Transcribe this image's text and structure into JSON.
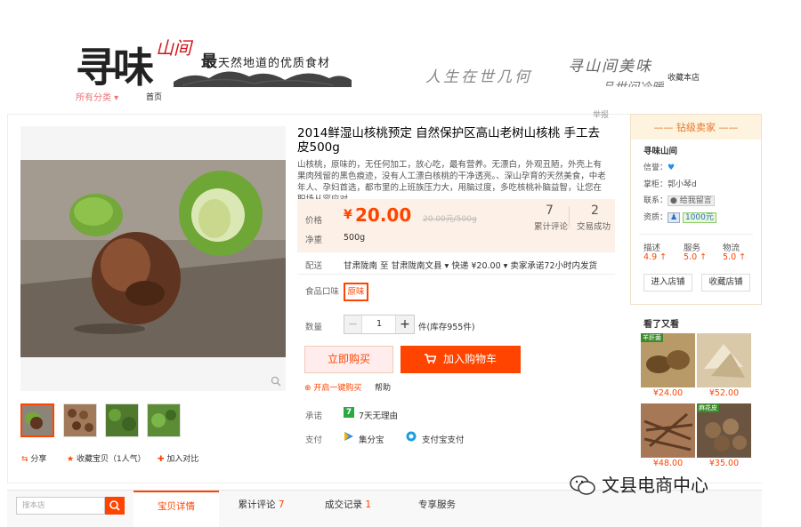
{
  "banner": {
    "logo_main": "寻味",
    "logo_red": "山间",
    "slogan_first": "最",
    "slogan_rest": "天然地道的优质食材",
    "text1": "人生在世几何",
    "text2": "寻山间美味",
    "text3": "品世间冷暖",
    "fav_shop": "收藏本店"
  },
  "nav": {
    "categories": "所有分类 ▾",
    "home": "首页"
  },
  "report": "举报",
  "product": {
    "title": "2014鲜湿山核桃预定 自然保护区高山老树山核桃 手工去皮500g",
    "description": "山核桃，原味的，无任何加工，放心吃，最有营养。无漂白，外观丑陋，外壳上有果肉残留的黑色痕迹，没有人工漂白核桃的干净透亮。、深山孕育的天然美食，中老年人、孕妇首选，都市里的上班族压力大，用脑过度，多吃核桃补脑益智，让您在职场从容应对",
    "price_label": "价格",
    "currency": "¥",
    "price": "20.00",
    "unit_price": "20.00元/500g",
    "reviews_count": "7",
    "reviews_label": "累计评论",
    "sales_count": "2",
    "sales_label": "交易成功",
    "weight_label": "净重",
    "weight": "500g",
    "shipping_label": "配送",
    "shipping": "甘肃陇南 至  甘肃陇南文县 ▾  快递 ¥20.00 ▾    卖家承诺72小时内发货",
    "flavor_label": "食品口味",
    "flavor_option": "原味",
    "qty_label": "数量",
    "qty_minus": "−",
    "qty": "1",
    "qty_plus": "+",
    "qty_unit": "件(库存955件)",
    "buy_now": "立即购买",
    "add_cart": "加入购物车",
    "onekey": "开启一键购买",
    "help": "帮助",
    "promise_label": "承诺",
    "promise_icon": "7",
    "promise": "7天无理由",
    "pay_label": "支付",
    "pay1": "集分宝",
    "pay2": "支付宝支付",
    "share": "分享",
    "collect": "收藏宝贝（1人气）",
    "compare": "加入对比"
  },
  "seller": {
    "title": "钻级卖家",
    "shop_name": "寻味山间",
    "credit_label": "信誉：",
    "keeper": "掌柜：郭小琴d",
    "contact_label": "联系：",
    "contact": "给我留言",
    "deposit_label": "资质：",
    "deposit": "1000元",
    "ratings": [
      {
        "label": "描述",
        "value": "4.9 ↑"
      },
      {
        "label": "服务",
        "value": "5.0 ↑"
      },
      {
        "label": "物流",
        "value": "5.0 ↑"
      }
    ],
    "enter_shop": "进入店铺",
    "fav_shop": "收藏店铺"
  },
  "also_viewed": {
    "title": "看了又看",
    "items": [
      {
        "price": "¥24.00",
        "tag": "羊肝菌"
      },
      {
        "price": "¥52.00",
        "tag": ""
      },
      {
        "price": "¥48.00",
        "tag": ""
      },
      {
        "price": "¥35.00",
        "tag": "麻花皮"
      }
    ]
  },
  "tabs": {
    "search_placeholder": "搜本店",
    "detail": "宝贝详情",
    "review": "累计评论",
    "review_count": "7",
    "records": "成交记录",
    "records_count": "1",
    "service": "专享服务"
  },
  "watermark": "文县电商中心"
}
